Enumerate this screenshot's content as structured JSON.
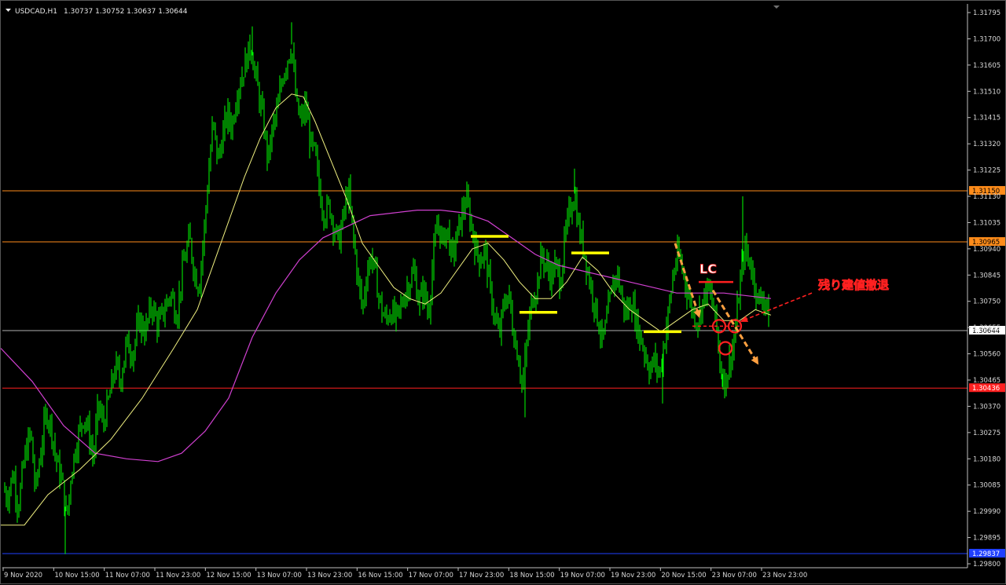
{
  "window": {
    "symbol": "USDCAD,H1",
    "ohlc": "1.30737 1.30752 1.30637 1.30644"
  },
  "colors": {
    "background": "#000000",
    "candle": "#00ff00",
    "grid_axis": "#c0c0c0",
    "ma_fast": "#f0f080",
    "ma_slow": "#d040d0",
    "level_orange": "#ff8c1a",
    "level_red": "#ff2020",
    "level_blue": "#2040ff",
    "bid_line": "#b0b0b0",
    "annotation_yellow": "#ffff00",
    "annotation_red": "#ff2020",
    "annotation_orange": "#ffa040"
  },
  "chart_data": {
    "type": "candlestick",
    "ylim": [
      1.298,
      1.31795
    ],
    "y_ticks": [
      "1.31795",
      "1.31700",
      "1.31605",
      "1.31510",
      "1.31415",
      "1.31320",
      "1.31225",
      "1.31130",
      "1.31035",
      "1.30940",
      "1.30845",
      "1.30750",
      "1.30655",
      "1.30560",
      "1.30465",
      "1.30370",
      "1.30275",
      "1.30180",
      "1.30085",
      "1.29990",
      "1.29895",
      "1.29800"
    ],
    "x_ticks": [
      "9 Nov 2020",
      "10 Nov 15:00",
      "11 Nov 07:00",
      "11 Nov 23:00",
      "12 Nov 15:00",
      "13 Nov 07:00",
      "13 Nov 23:00",
      "16 Nov 15:00",
      "17 Nov 07:00",
      "17 Nov 23:00",
      "18 Nov 15:00",
      "19 Nov 07:00",
      "19 Nov 23:00",
      "20 Nov 15:00",
      "23 Nov 07:00",
      "23 Nov 23:00"
    ],
    "levels": [
      {
        "price": 1.3115,
        "label": "1.31150",
        "style": "orange"
      },
      {
        "price": 1.30965,
        "label": "1.30965",
        "style": "orange"
      },
      {
        "price": 1.30644,
        "label": "1.30644",
        "style": "bid"
      },
      {
        "price": 1.30436,
        "label": "1.30436",
        "style": "red"
      },
      {
        "price": 1.29837,
        "label": "1.29837",
        "style": "blue"
      }
    ],
    "close_path": [
      [
        0,
        1.301
      ],
      [
        8,
        1.3004
      ],
      [
        16,
        1.3013
      ],
      [
        22,
        1.3
      ],
      [
        30,
        1.3018
      ],
      [
        38,
        1.3028
      ],
      [
        44,
        1.3006
      ],
      [
        52,
        1.3023
      ],
      [
        58,
        1.3035
      ],
      [
        64,
        1.303
      ],
      [
        70,
        1.3018
      ],
      [
        78,
        1.301
      ],
      [
        84,
        1.2996
      ],
      [
        90,
        1.3014
      ],
      [
        98,
        1.3026
      ],
      [
        106,
        1.3034
      ],
      [
        112,
        1.3027
      ],
      [
        118,
        1.3018
      ],
      [
        124,
        1.3038
      ],
      [
        130,
        1.303
      ],
      [
        138,
        1.304
      ],
      [
        146,
        1.3052
      ],
      [
        152,
        1.3046
      ],
      [
        160,
        1.306
      ],
      [
        168,
        1.3056
      ],
      [
        176,
        1.3068
      ],
      [
        184,
        1.3064
      ],
      [
        192,
        1.3074
      ],
      [
        200,
        1.3066
      ],
      [
        208,
        1.3072
      ],
      [
        216,
        1.3078
      ],
      [
        224,
        1.307
      ],
      [
        232,
        1.3088
      ],
      [
        240,
        1.3098
      ],
      [
        246,
        1.3086
      ],
      [
        252,
        1.308
      ],
      [
        258,
        1.3098
      ],
      [
        264,
        1.312
      ],
      [
        270,
        1.314
      ],
      [
        276,
        1.3126
      ],
      [
        282,
        1.3134
      ],
      [
        288,
        1.3143
      ],
      [
        294,
        1.3138
      ],
      [
        300,
        1.315
      ],
      [
        306,
        1.3156
      ],
      [
        312,
        1.3162
      ],
      [
        318,
        1.3168
      ],
      [
        322,
        1.316
      ],
      [
        328,
        1.315
      ],
      [
        334,
        1.314
      ],
      [
        340,
        1.3126
      ],
      [
        346,
        1.3138
      ],
      [
        352,
        1.3144
      ],
      [
        358,
        1.3156
      ],
      [
        364,
        1.3162
      ],
      [
        370,
        1.3168
      ],
      [
        376,
        1.3146
      ],
      [
        382,
        1.314
      ],
      [
        388,
        1.3146
      ],
      [
        394,
        1.3132
      ],
      [
        400,
        1.3128
      ],
      [
        406,
        1.3114
      ],
      [
        412,
        1.3106
      ],
      [
        418,
        1.311
      ],
      [
        424,
        1.3102
      ],
      [
        430,
        1.3096
      ],
      [
        436,
        1.3106
      ],
      [
        442,
        1.3116
      ],
      [
        448,
        1.31
      ],
      [
        454,
        1.3084
      ],
      [
        460,
        1.3072
      ],
      [
        466,
        1.3086
      ],
      [
        472,
        1.3092
      ],
      [
        478,
        1.3082
      ],
      [
        484,
        1.3072
      ],
      [
        490,
        1.3068
      ],
      [
        496,
        1.3072
      ],
      [
        502,
        1.3068
      ],
      [
        508,
        1.3072
      ],
      [
        514,
        1.3078
      ],
      [
        520,
        1.3082
      ],
      [
        526,
        1.3086
      ],
      [
        532,
        1.3074
      ],
      [
        538,
        1.308
      ],
      [
        544,
        1.307
      ],
      [
        550,
        1.309
      ],
      [
        556,
        1.3104
      ],
      [
        562,
        1.3096
      ],
      [
        568,
        1.3102
      ],
      [
        574,
        1.309
      ],
      [
        580,
        1.3098
      ],
      [
        586,
        1.3106
      ],
      [
        592,
        1.3112
      ],
      [
        598,
        1.3104
      ],
      [
        604,
        1.3094
      ],
      [
        610,
        1.309
      ],
      [
        616,
        1.3094
      ],
      [
        622,
        1.308
      ],
      [
        628,
        1.307
      ],
      [
        634,
        1.3062
      ],
      [
        640,
        1.3074
      ],
      [
        646,
        1.3078
      ],
      [
        652,
        1.3064
      ],
      [
        658,
        1.3056
      ],
      [
        664,
        1.3044
      ],
      [
        670,
        1.3062
      ],
      [
        676,
        1.3076
      ],
      [
        682,
        1.308
      ],
      [
        688,
        1.3092
      ],
      [
        694,
        1.3088
      ],
      [
        700,
        1.3084
      ],
      [
        706,
        1.3088
      ],
      [
        712,
        1.3082
      ],
      [
        718,
        1.3098
      ],
      [
        724,
        1.3108
      ],
      [
        730,
        1.3114
      ],
      [
        736,
        1.31
      ],
      [
        742,
        1.3094
      ],
      [
        748,
        1.3084
      ],
      [
        754,
        1.3076
      ],
      [
        760,
        1.3068
      ],
      [
        766,
        1.306
      ],
      [
        772,
        1.307
      ],
      [
        778,
        1.308
      ],
      [
        784,
        1.3086
      ],
      [
        790,
        1.3076
      ],
      [
        796,
        1.307
      ],
      [
        802,
        1.3076
      ],
      [
        808,
        1.3068
      ],
      [
        814,
        1.3062
      ],
      [
        820,
        1.3056
      ],
      [
        826,
        1.305
      ],
      [
        832,
        1.3054
      ],
      [
        838,
        1.3048
      ],
      [
        844,
        1.306
      ],
      [
        850,
        1.3072
      ],
      [
        856,
        1.3086
      ],
      [
        862,
        1.3092
      ],
      [
        868,
        1.3086
      ],
      [
        874,
        1.3078
      ],
      [
        880,
        1.3072
      ],
      [
        886,
        1.3068
      ],
      [
        892,
        1.3074
      ],
      [
        898,
        1.308
      ],
      [
        904,
        1.3076
      ],
      [
        910,
        1.3068
      ],
      [
        916,
        1.305
      ],
      [
        922,
        1.3046
      ],
      [
        928,
        1.3054
      ],
      [
        934,
        1.3062
      ],
      [
        940,
        1.308
      ],
      [
        946,
        1.3094
      ],
      [
        952,
        1.309
      ],
      [
        958,
        1.3084
      ],
      [
        964,
        1.3074
      ],
      [
        970,
        1.3078
      ],
      [
        976,
        1.307
      ],
      [
        980,
        1.30644
      ]
    ],
    "ma_fast": [
      [
        0,
        1.2994
      ],
      [
        30,
        1.2994
      ],
      [
        60,
        1.3005
      ],
      [
        100,
        1.3014
      ],
      [
        140,
        1.3025
      ],
      [
        180,
        1.304
      ],
      [
        220,
        1.3058
      ],
      [
        250,
        1.3072
      ],
      [
        280,
        1.3096
      ],
      [
        310,
        1.312
      ],
      [
        330,
        1.3134
      ],
      [
        350,
        1.3145
      ],
      [
        370,
        1.315
      ],
      [
        385,
        1.3149
      ],
      [
        400,
        1.314
      ],
      [
        420,
        1.3126
      ],
      [
        440,
        1.3112
      ],
      [
        460,
        1.3096
      ],
      [
        480,
        1.3088
      ],
      [
        500,
        1.308
      ],
      [
        520,
        1.3076
      ],
      [
        540,
        1.3074
      ],
      [
        560,
        1.3078
      ],
      [
        580,
        1.3086
      ],
      [
        600,
        1.3094
      ],
      [
        620,
        1.3096
      ],
      [
        640,
        1.309
      ],
      [
        660,
        1.3082
      ],
      [
        680,
        1.3076
      ],
      [
        700,
        1.3076
      ],
      [
        720,
        1.3082
      ],
      [
        740,
        1.3091
      ],
      [
        760,
        1.3086
      ],
      [
        780,
        1.3078
      ],
      [
        800,
        1.3072
      ],
      [
        820,
        1.3068
      ],
      [
        840,
        1.3064
      ],
      [
        860,
        1.3068
      ],
      [
        880,
        1.3072
      ],
      [
        900,
        1.3074
      ],
      [
        920,
        1.3068
      ],
      [
        940,
        1.3068
      ],
      [
        960,
        1.3072
      ],
      [
        980,
        1.307
      ]
    ],
    "ma_slow": [
      [
        0,
        1.3058
      ],
      [
        40,
        1.3046
      ],
      [
        80,
        1.303
      ],
      [
        120,
        1.302
      ],
      [
        160,
        1.3018
      ],
      [
        200,
        1.3017
      ],
      [
        230,
        1.302
      ],
      [
        260,
        1.3028
      ],
      [
        290,
        1.304
      ],
      [
        320,
        1.3062
      ],
      [
        350,
        1.3078
      ],
      [
        380,
        1.309
      ],
      [
        410,
        1.3098
      ],
      [
        440,
        1.3102
      ],
      [
        470,
        1.3106
      ],
      [
        500,
        1.3107
      ],
      [
        530,
        1.3108
      ],
      [
        560,
        1.3108
      ],
      [
        590,
        1.3107
      ],
      [
        620,
        1.3104
      ],
      [
        650,
        1.3098
      ],
      [
        680,
        1.3092
      ],
      [
        710,
        1.3088
      ],
      [
        740,
        1.3086
      ],
      [
        770,
        1.3084
      ],
      [
        800,
        1.3082
      ],
      [
        830,
        1.308
      ],
      [
        860,
        1.3078
      ],
      [
        890,
        1.3078
      ],
      [
        920,
        1.3078
      ],
      [
        950,
        1.3077
      ],
      [
        980,
        1.3076
      ]
    ],
    "annotations": {
      "lc_label": "LC",
      "note": "残り建値撤退",
      "yellow_marks": [
        {
          "x0": 598,
          "x1": 646,
          "price": 1.30985
        },
        {
          "x0": 660,
          "x1": 708,
          "price": 1.3071
        },
        {
          "x0": 726,
          "x1": 774,
          "price": 1.30925
        },
        {
          "x0": 818,
          "x1": 866,
          "price": 1.3064
        }
      ],
      "red_stop": {
        "x0": 888,
        "x1": 932,
        "price": 1.3082
      },
      "red_dash": {
        "x0": 880,
        "x1": 940,
        "price": 1.3066
      },
      "circles": [
        {
          "x": 914,
          "price": 1.3066
        },
        {
          "x": 934,
          "price": 1.3066
        },
        {
          "x": 922,
          "price": 1.3058
        }
      ],
      "arrows": [
        {
          "x0": 858,
          "p0": 1.3096,
          "x1": 888,
          "p1": 1.307
        },
        {
          "x0": 906,
          "p0": 1.3079,
          "x1": 962,
          "p1": 1.3053
        }
      ],
      "note_arrow": {
        "x0": 1032,
        "p0": 1.3078,
        "x1": 944,
        "p1": 1.3068
      }
    }
  }
}
